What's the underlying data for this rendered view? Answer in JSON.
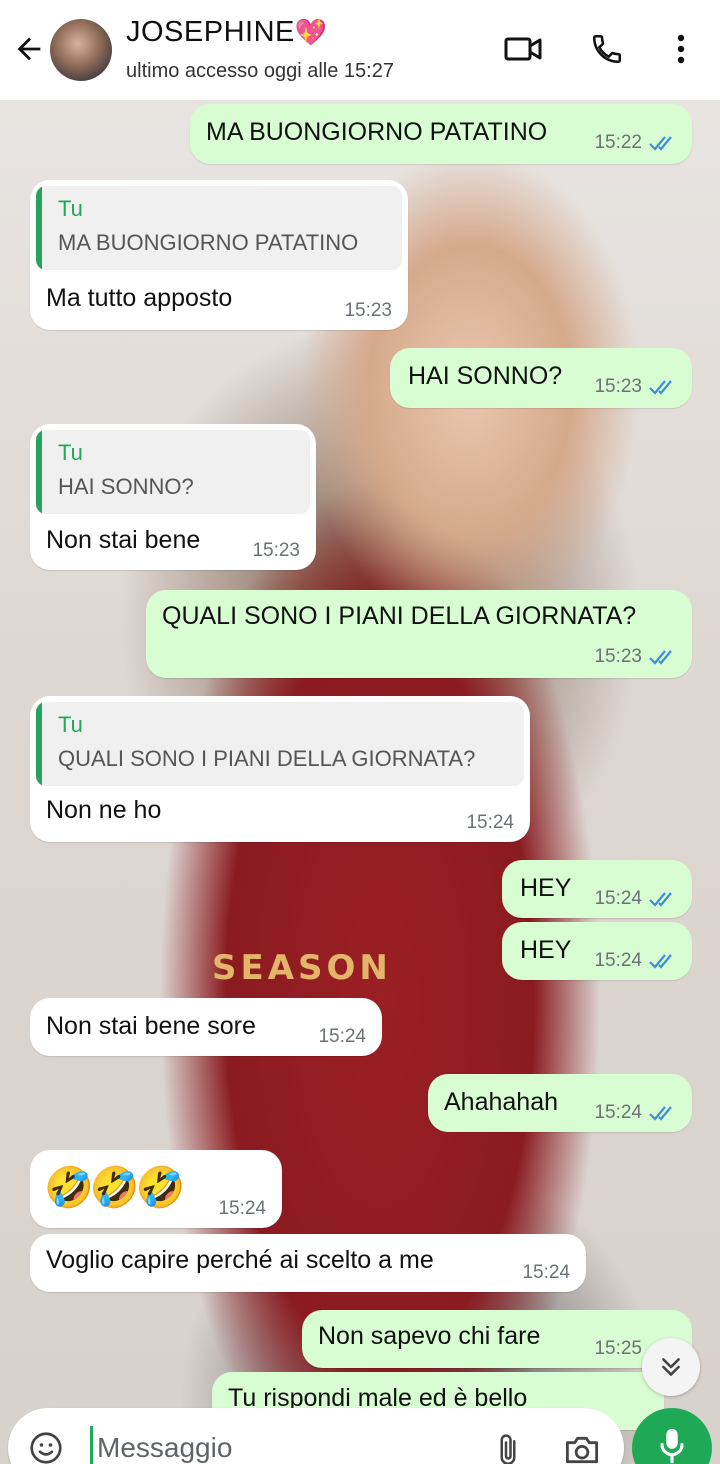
{
  "header": {
    "contact_name": "JOSEPHINE",
    "contact_emoji": "💖",
    "last_seen": "ultimo accesso oggi alle 15:27",
    "icons": [
      "arrow-left-icon",
      "avatar",
      "video-call-icon",
      "phone-icon",
      "more-vert-icon"
    ]
  },
  "wallpaper": {
    "shirt_text": "SEASON"
  },
  "messages": [
    {
      "dir": "out",
      "text": "MA BUONGIORNO PATATINO",
      "time": "15:22",
      "read": true
    },
    {
      "dir": "in",
      "quote_author": "Tu",
      "quote_text": "MA BUONGIORNO PATATINO",
      "text": "Ma tutto apposto",
      "time": "15:23"
    },
    {
      "dir": "out",
      "text": "HAI SONNO?",
      "time": "15:23",
      "read": true
    },
    {
      "dir": "in",
      "quote_author": "Tu",
      "quote_text": "HAI SONNO?",
      "text": "Non stai bene",
      "time": "15:23"
    },
    {
      "dir": "out",
      "text": "QUALI SONO I PIANI DELLA GIORNATA?",
      "time": "15:23",
      "read": true
    },
    {
      "dir": "in",
      "quote_author": "Tu",
      "quote_text": "QUALI SONO I PIANI DELLA GIORNATA?",
      "text": "Non ne ho",
      "time": "15:24"
    },
    {
      "dir": "out",
      "text": "HEY",
      "time": "15:24",
      "read": true
    },
    {
      "dir": "out",
      "text": "HEY",
      "time": "15:24",
      "read": true
    },
    {
      "dir": "in",
      "text": "Non stai bene sore",
      "time": "15:24"
    },
    {
      "dir": "out",
      "text": "Ahahahah",
      "time": "15:24",
      "read": true
    },
    {
      "dir": "in",
      "text": "🤣🤣🤣",
      "time": "15:24"
    },
    {
      "dir": "in",
      "text": "Voglio capire perché ai scelto a me",
      "time": "15:24"
    },
    {
      "dir": "out",
      "text": "Non sapevo chi fare",
      "time": "15:25",
      "read": true
    },
    {
      "dir": "out",
      "text": "Tu rispondi male ed è bello",
      "time": "",
      "read": false
    }
  ],
  "composer": {
    "placeholder": "Messaggio",
    "icons": [
      "emoji-icon",
      "attach-icon",
      "camera-icon",
      "mic-icon"
    ]
  },
  "colors": {
    "accent": "#1fa855",
    "outgoing_bubble": "#d9fdd3",
    "incoming_bubble": "#ffffff",
    "read_ticks": "#3b8fd8"
  }
}
